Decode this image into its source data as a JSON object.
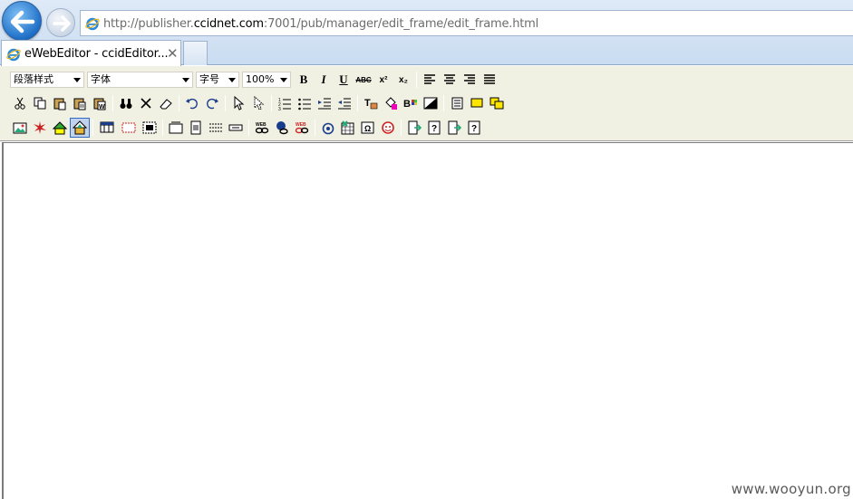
{
  "browser": {
    "url_prefix": "http://publisher.",
    "url_host": "ccidnet.com",
    "url_suffix": ":7001/pub/manager/edit_frame/edit_frame.html",
    "tab_title": "eWebEditor - ccidEditor...",
    "tab_close": "✕"
  },
  "toolbar": {
    "format_select": "段落样式",
    "font_select": "字体",
    "size_select": "字号",
    "zoom_select": "100%",
    "bold": "B",
    "italic": "I",
    "underline": "U",
    "strike": "ABC",
    "superscript": "x²",
    "subscript": "x₂"
  },
  "watermark": "www.wooyun.org",
  "colors": {
    "toolbar_bg": "#f1f1e3",
    "chrome_bg": "#c9dcf1",
    "accent": "#1e6fc7"
  }
}
